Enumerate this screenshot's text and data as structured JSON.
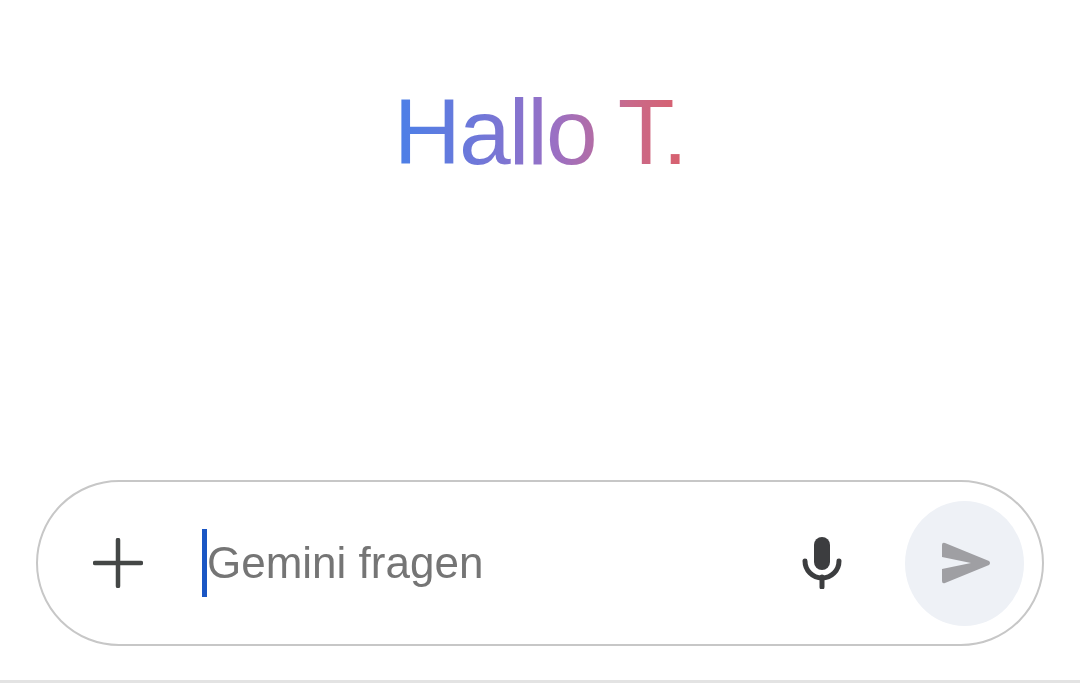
{
  "greeting": "Hallo T.",
  "input": {
    "placeholder": "Gemini fragen",
    "focused": true
  },
  "send_button": {
    "disabled": true
  }
}
